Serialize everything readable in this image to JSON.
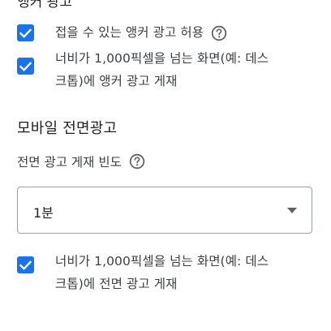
{
  "top_section": {
    "cut_heading": "앵커 광고"
  },
  "anchor_ads": {
    "collapsible": {
      "label": "접을 수 있는 앵커 광고 허용",
      "checked": true,
      "help_icon": "help-circle-icon"
    },
    "desktop": {
      "label_line1": "너비가 1,000픽셀을 넘는 화면(예: 데스",
      "label_line2": "크톱)에 앵커 광고 게재",
      "checked": true
    }
  },
  "mobile_interstitial": {
    "title": "모바일 전면광고",
    "frequency_label": "전면 광고 게재 빈도",
    "help_icon": "help-circle-icon",
    "frequency_select": {
      "value": "1분",
      "icon": "dropdown-arrow-icon"
    },
    "desktop": {
      "label_line1": "너비가 1,000픽셀을 넘는 화면(예: 데스",
      "label_line2": "크톱)에 전면 광고 게재",
      "checked": true
    }
  },
  "colors": {
    "accent": "#1a73e8",
    "text_primary": "#202124",
    "text_secondary": "#3c4043",
    "border": "#9aa0a6",
    "icon": "#5f6368"
  }
}
